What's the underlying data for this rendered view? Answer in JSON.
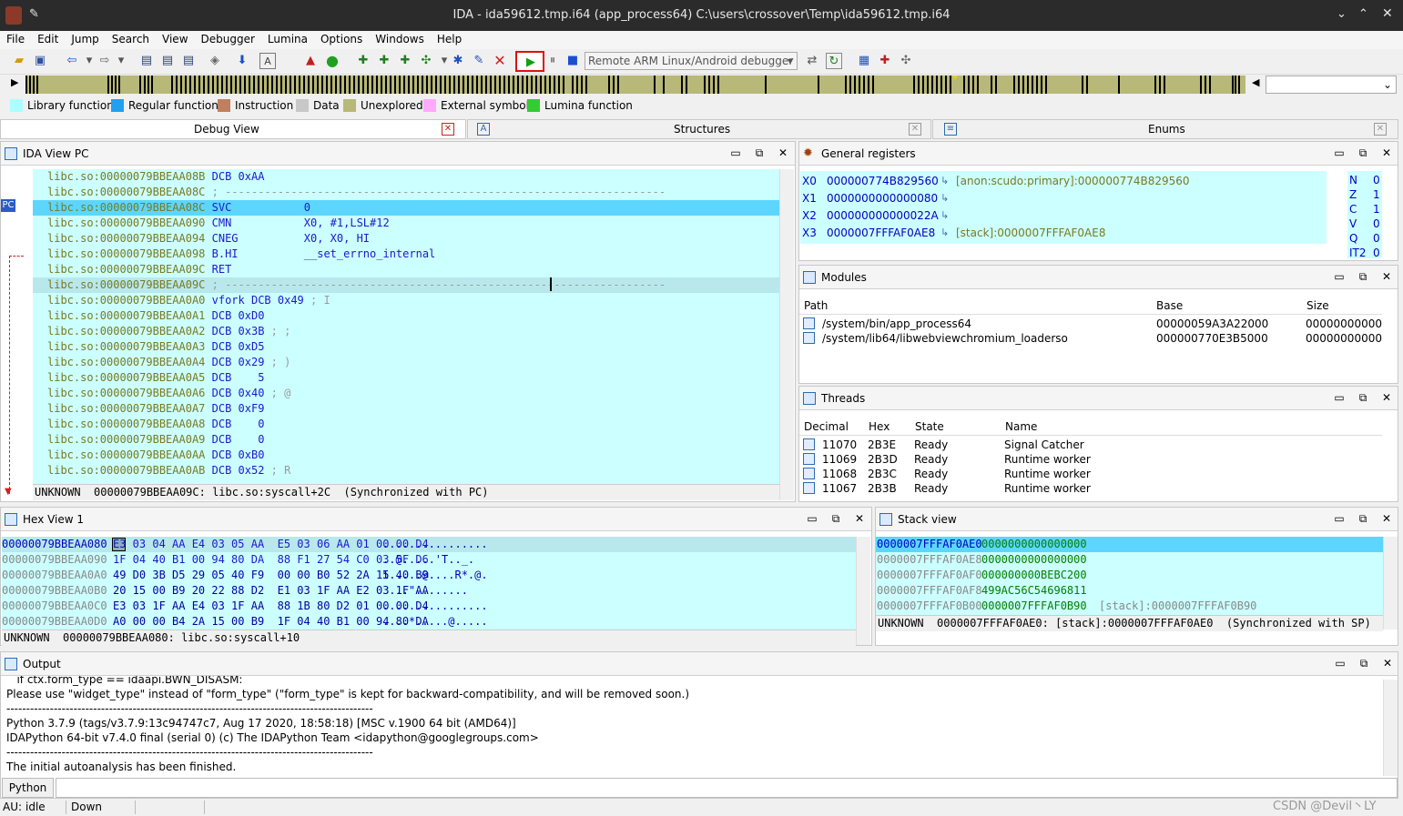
{
  "window": {
    "title": "IDA - ida59612.tmp.i64 (app_process64) C:\\users\\crossover\\Temp\\ida59612.tmp.i64"
  },
  "menu": [
    "File",
    "Edit",
    "Jump",
    "Search",
    "View",
    "Debugger",
    "Lumina",
    "Options",
    "Windows",
    "Help"
  ],
  "toolbar": {
    "debugger_select": "Remote ARM Linux/Android debugger"
  },
  "legend": [
    {
      "label": "Library function",
      "color": "#aaffff"
    },
    {
      "label": "Regular function",
      "color": "#1fa0f0"
    },
    {
      "label": "Instruction",
      "color": "#c08060"
    },
    {
      "label": "Data",
      "color": "#c8c8c8"
    },
    {
      "label": "Unexplored",
      "color": "#b8b878"
    },
    {
      "label": "External symbol",
      "color": "#ffaaff"
    },
    {
      "label": "Lumina function",
      "color": "#33cc33"
    }
  ],
  "tabs": {
    "debug_view": "Debug View",
    "structures": "Structures",
    "enums": "Enums"
  },
  "ida_view": {
    "title": "IDA View PC",
    "pc_label": "PC",
    "lines": [
      {
        "addr": "libc.so:00000079BBEAA08B",
        "ins": "DCB 0xAA",
        "cmt": ""
      },
      {
        "addr": "libc.so:00000079BBEAA08C",
        "ins": "",
        "cmt": "; -------------------------------------------------------------------"
      },
      {
        "addr": "libc.so:00000079BBEAA08C",
        "ins": "SVC           0",
        "cmt": ""
      },
      {
        "addr": "libc.so:00000079BBEAA090",
        "ins": "CMN           X0, #1,LSL#12",
        "cmt": ""
      },
      {
        "addr": "libc.so:00000079BBEAA094",
        "ins": "CNEG          X0, X0, HI",
        "cmt": ""
      },
      {
        "addr": "libc.so:00000079BBEAA098",
        "ins": "B.HI          __set_errno_internal",
        "cmt": ""
      },
      {
        "addr": "libc.so:00000079BBEAA09C",
        "ins": "RET",
        "cmt": ""
      },
      {
        "addr": "libc.so:00000079BBEAA09C",
        "ins": "",
        "cmt": "; -------------------------------------------------------------------"
      },
      {
        "addr": "libc.so:00000079BBEAA0A0",
        "ins": "vfork DCB 0x49",
        "cmt": " ; I"
      },
      {
        "addr": "libc.so:00000079BBEAA0A1",
        "ins": "DCB 0xD0",
        "cmt": ""
      },
      {
        "addr": "libc.so:00000079BBEAA0A2",
        "ins": "DCB 0x3B",
        "cmt": " ; ;"
      },
      {
        "addr": "libc.so:00000079BBEAA0A3",
        "ins": "DCB 0xD5",
        "cmt": ""
      },
      {
        "addr": "libc.so:00000079BBEAA0A4",
        "ins": "DCB 0x29",
        "cmt": " ; )"
      },
      {
        "addr": "libc.so:00000079BBEAA0A5",
        "ins": "DCB    5",
        "cmt": ""
      },
      {
        "addr": "libc.so:00000079BBEAA0A6",
        "ins": "DCB 0x40",
        "cmt": " ; @"
      },
      {
        "addr": "libc.so:00000079BBEAA0A7",
        "ins": "DCB 0xF9",
        "cmt": ""
      },
      {
        "addr": "libc.so:00000079BBEAA0A8",
        "ins": "DCB    0",
        "cmt": ""
      },
      {
        "addr": "libc.so:00000079BBEAA0A9",
        "ins": "DCB    0",
        "cmt": ""
      },
      {
        "addr": "libc.so:00000079BBEAA0AA",
        "ins": "DCB 0xB0",
        "cmt": ""
      },
      {
        "addr": "libc.so:00000079BBEAA0AB",
        "ins": "DCB 0x52",
        "cmt": " ; R"
      }
    ],
    "status": "UNKNOWN  00000079BBEAA09C: libc.so:syscall+2C  (Synchronized with PC)"
  },
  "registers": {
    "title": "General registers",
    "rows": [
      {
        "name": "X0",
        "value": "000000774B829560",
        "desc": "[anon:scudo:primary]:000000774B829560"
      },
      {
        "name": "X1",
        "value": "0000000000000080",
        "desc": ""
      },
      {
        "name": "X2",
        "value": "000000000000022A",
        "desc": ""
      },
      {
        "name": "X3",
        "value": "0000007FFFAF0AE8",
        "desc": "[stack]:0000007FFFAF0AE8"
      }
    ],
    "flags": [
      {
        "n": "N",
        "v": "0"
      },
      {
        "n": "Z",
        "v": "1"
      },
      {
        "n": "C",
        "v": "1"
      },
      {
        "n": "V",
        "v": "0"
      },
      {
        "n": "Q",
        "v": "0"
      },
      {
        "n": "IT2",
        "v": "0"
      }
    ]
  },
  "modules": {
    "title": "Modules",
    "headers": [
      "Path",
      "Base",
      "Size"
    ],
    "rows": [
      {
        "path": "/system/bin/app_process64",
        "base": "00000059A3A22000",
        "size": "000000000000"
      },
      {
        "path": "/system/lib64/libwebviewchromium_loaderso",
        "base": "000000770E3B5000",
        "size": "000000000000"
      }
    ]
  },
  "threads": {
    "title": "Threads",
    "headers": [
      "Decimal",
      "Hex",
      "State",
      "Name"
    ],
    "rows": [
      {
        "dec": "11070",
        "hex": "2B3E",
        "state": "Ready",
        "name": "Signal Catcher"
      },
      {
        "dec": "11069",
        "hex": "2B3D",
        "state": "Ready",
        "name": "Runtime worker"
      },
      {
        "dec": "11068",
        "hex": "2B3C",
        "state": "Ready",
        "name": "Runtime worker"
      },
      {
        "dec": "11067",
        "hex": "2B3B",
        "state": "Ready",
        "name": "Runtime worker"
      }
    ]
  },
  "hex_view": {
    "title": "Hex View 1",
    "rows": [
      {
        "addr": "00000079BBEAA080",
        "bytes": "E3 03 04 AA E4 03 05 AA  E5 03 06 AA 01 00 00 D4",
        "ascii": "................"
      },
      {
        "addr": "00000079BBEAA090",
        "bytes": "1F 04 40 B1 00 94 80 DA  88 F1 27 54 C0 03 5F D6",
        "ascii": "..@.....'T.._."
      },
      {
        "addr": "00000079BBEAA0A0",
        "bytes": "49 D0 3B D5 29 05 40 F9  00 00 B0 52 2A 15 40 B9",
        "ascii": "I.....@....R*.@."
      },
      {
        "addr": "00000079BBEAA0B0",
        "bytes": "20 15 00 B9 20 22 88 D2  E1 03 1F AA E2 03 1F AA",
        "ascii": " ...\"........"
      },
      {
        "addr": "00000079BBEAA0C0",
        "bytes": "E3 03 1F AA E4 03 1F AA  88 1B 80 D2 01 00 00 D4",
        "ascii": "................"
      },
      {
        "addr": "00000079BBEAA0D0",
        "bytes": "A0 00 00 B4 2A 15 00 B9  1F 04 40 B1 00 94 80 DA",
        "ascii": "....*.....@....."
      }
    ],
    "status": "UNKNOWN  00000079BBEAA080: libc.so:syscall+10"
  },
  "stack_view": {
    "title": "Stack view",
    "rows": [
      {
        "addr": "0000007FFFAF0AE0",
        "val": "0000000000000000",
        "note": ""
      },
      {
        "addr": "0000007FFFAF0AE8",
        "val": "0000000000000000",
        "note": ""
      },
      {
        "addr": "0000007FFFAF0AF0",
        "val": "000000000BEBC200",
        "note": ""
      },
      {
        "addr": "0000007FFFAF0AF8",
        "val": "499AC56C54696811",
        "note": ""
      },
      {
        "addr": "0000007FFFAF0B00",
        "val": "0000007FFFAF0B90",
        "note": "[stack]:0000007FFFAF0B90"
      }
    ],
    "status": "UNKNOWN  0000007FFFAF0AE0: [stack]:0000007FFFAF0AE0  (Synchronized with SP)"
  },
  "output": {
    "title": "Output",
    "lines": [
      "   if ctx.form_type == idaapi.BWN_DISASM:",
      "Please use \"widget_type\" instead of \"form_type\" (\"form_type\" is kept for backward-compatibility, and will be removed soon.)",
      "---------------------------------------------------------------------------------------------",
      "Python 3.7.9 (tags/v3.7.9:13c94747c7, Aug 17 2020, 18:58:18) [MSC v.1900 64 bit (AMD64)]",
      "IDAPython 64-bit v7.4.0 final (serial 0) (c) The IDAPython Team <idapython@googlegroups.com>",
      "---------------------------------------------------------------------------------------------",
      "The initial autoanalysis has been finished."
    ],
    "python_button": "Python"
  },
  "statusbar": {
    "au_label": "AU:",
    "au_state": "idle",
    "direction": "Down",
    "watermark": "CSDN @Devil丶LY"
  }
}
